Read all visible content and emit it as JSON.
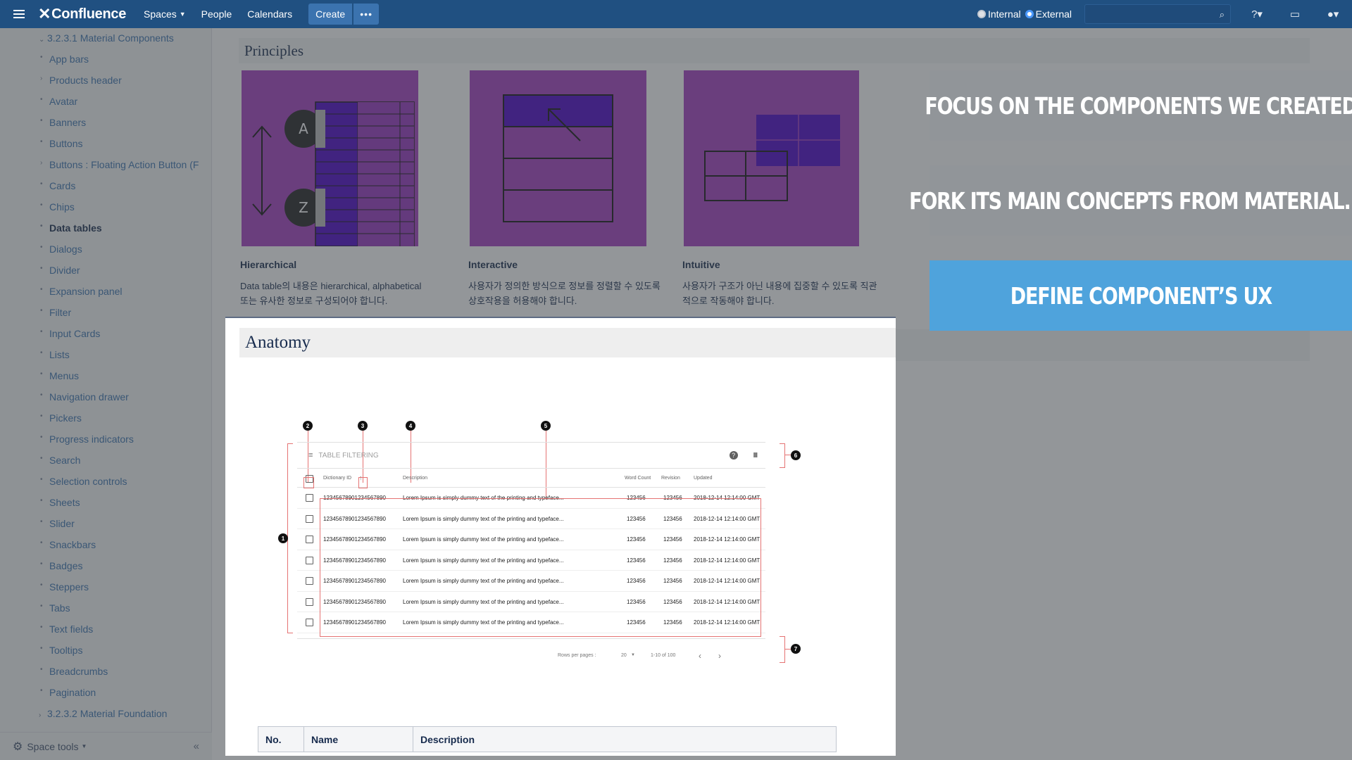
{
  "topbar": {
    "logo": "Confluence",
    "nav": [
      "Spaces",
      "People",
      "Calendars"
    ],
    "create": "Create",
    "more": "•••",
    "toggle_internal": "Internal",
    "toggle_external": "External"
  },
  "sidebar": {
    "parent_open": "3.2.3.1 Material Components",
    "items": [
      "App bars",
      "Products header",
      "Avatar",
      "Banners",
      "Buttons",
      "Buttons : Floating Action Button (F",
      "Cards",
      "Chips",
      "Data tables",
      "Dialogs",
      "Divider",
      "Expansion panel",
      "Filter",
      "Input Cards",
      "Lists",
      "Menus",
      "Navigation drawer",
      "Pickers",
      "Progress indicators",
      "Search",
      "Selection controls",
      "Sheets",
      "Slider",
      "Snackbars",
      "Badges",
      "Steppers",
      "Tabs",
      "Text fields",
      "Tooltips",
      "Breadcrumbs",
      "Pagination"
    ],
    "active_item": "Data tables",
    "parent_closed": "3.2.3.2 Material Foundation",
    "footer_label": "Space tools"
  },
  "principles": {
    "heading": "Principles",
    "cards": [
      {
        "title": "Hierarchical",
        "desc_line1": "Data table의 내용은 hierarchical, alphabetical",
        "desc_line2": "또는 유사한 정보로 구성되어야 합니다."
      },
      {
        "title": "Interactive",
        "desc_line1": "사용자가 정의한 방식으로 정보를 정렬할 수 있도록",
        "desc_line2": "상호작용을 허용해야 합니다."
      },
      {
        "title": "Intuitive",
        "desc_line1": "사용자가 구조가 아닌 내용에 집중할 수 있도록 직관",
        "desc_line2": "적으로 작동해야 합니다."
      }
    ]
  },
  "anatomy": {
    "heading": "Anatomy",
    "table_filter_label": "TABLE FILTERING",
    "columns": [
      "Dictionary ID",
      "Description",
      "Word Count",
      "Revision",
      "Updated"
    ],
    "row": {
      "id": "12345678901234567890",
      "desc": "Lorem Ipsum is simply dummy text of the printing and typeface...",
      "count": "123456",
      "rev": "123456",
      "updated": "2018-12-14 12:14:00 GMT"
    },
    "rows_count_label": "Rows per pages :",
    "rows_value": "20",
    "range": "1-10 of 100",
    "callouts": [
      "1",
      "2",
      "3",
      "4",
      "5",
      "6",
      "7"
    ]
  },
  "spec_table": {
    "headers": [
      "No.",
      "Name",
      "Description"
    ]
  },
  "slide_labels": [
    {
      "text": "FOCUS ON THE COMPONENTS WE CREATED",
      "active": false
    },
    {
      "text": "FORK ITS MAIN CONCEPTS FROM MATERIAL.IO",
      "active": false
    },
    {
      "text": "DEFINE COMPONENT’S UX",
      "active": true
    }
  ],
  "colors": {
    "topbar": "#205081",
    "principle_bg": "#a53dc0",
    "principle_accent": "#4a00c8",
    "label_gray": "#919599",
    "label_active": "#4fa3dc"
  }
}
